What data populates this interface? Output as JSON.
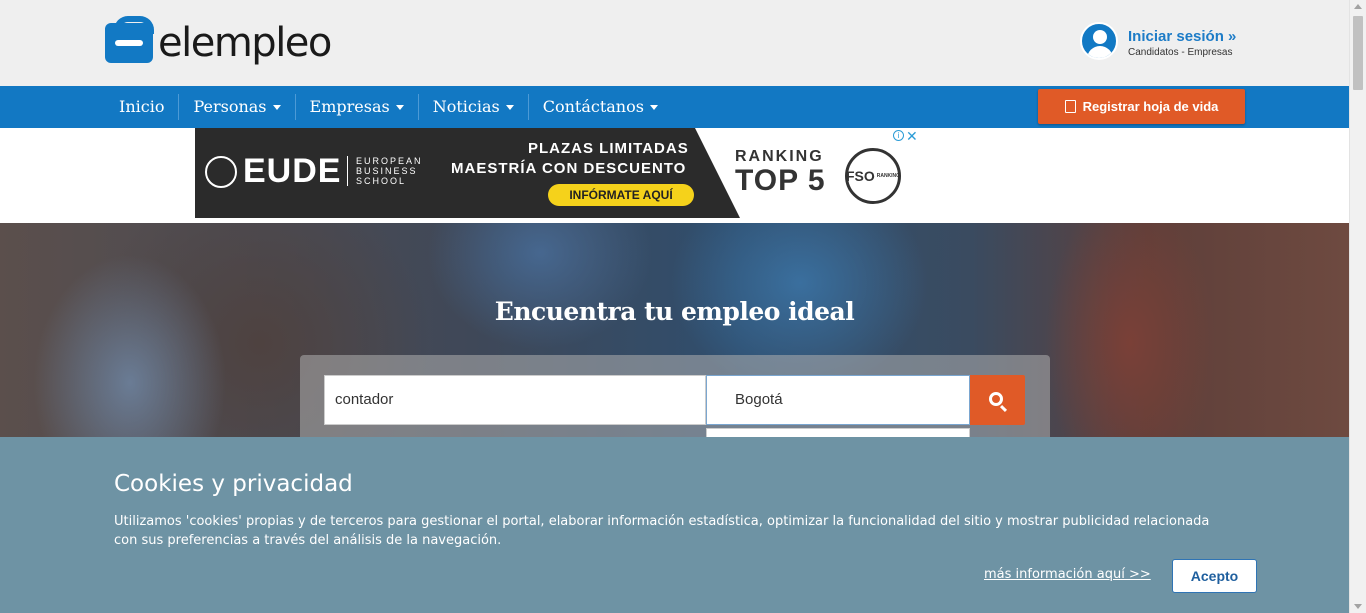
{
  "brand": {
    "logo_text": "elempleo"
  },
  "login": {
    "title": "Iniciar sesión »",
    "subtitle": "Candidatos - Empresas"
  },
  "nav": {
    "items": [
      {
        "label": "Inicio"
      },
      {
        "label": "Personas"
      },
      {
        "label": "Empresas"
      },
      {
        "label": "Noticias"
      },
      {
        "label": "Contáctanos"
      }
    ],
    "register_label": "Registrar hoja de vida"
  },
  "ad": {
    "brand": "EUDE",
    "school": "EUROPEAN BUSINESS SCHOOL",
    "line1": "PLAZAS LIMITADAS",
    "line2": "MAESTRÍA CON DESCUENTO",
    "cta": "INFÓRMATE AQUÍ",
    "ranking": "RANKING",
    "top": "TOP 5",
    "badge": "FSO",
    "badge_sub": "RANKING"
  },
  "hero": {
    "title": "Encuentra tu empleo ideal"
  },
  "search": {
    "keyword_value": "contador",
    "location_value": "Bogotá"
  },
  "cookie": {
    "title": "Cookies y privacidad",
    "text": "Utilizamos 'cookies' propias y de terceros para gestionar el portal, elaborar información estadística, optimizar la funcionalidad del sitio y mostrar publicidad relacionada con sus preferencias a través del análisis de la navegación.",
    "more_link": "más información aquí >>",
    "accept_label": "Acepto"
  },
  "colors": {
    "primary": "#1278c3",
    "accent": "#e05a27",
    "cookie_bg": "#6e93a4"
  }
}
